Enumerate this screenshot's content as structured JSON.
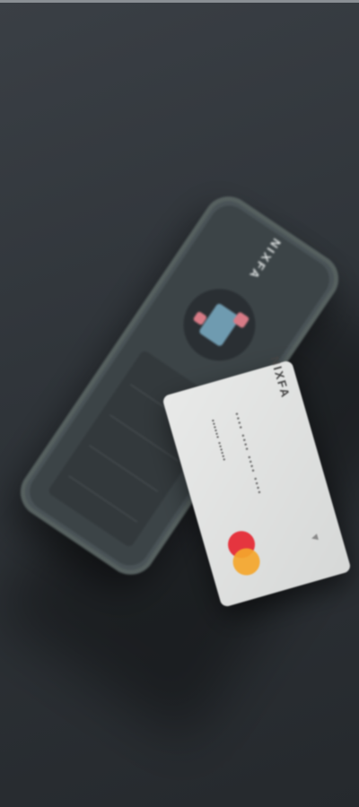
{
  "card": {
    "brand": "NIXFA",
    "number": "•••• •••• •••• ••••",
    "holder": "•••••• ••••••"
  },
  "phone": {
    "brand": "NIXFA"
  },
  "colors": {
    "background": "#2f3439",
    "phone": "#4a5357",
    "card": "#e3e4e3",
    "mc_red": "#e5353f",
    "mc_yellow": "#f4a62b"
  }
}
